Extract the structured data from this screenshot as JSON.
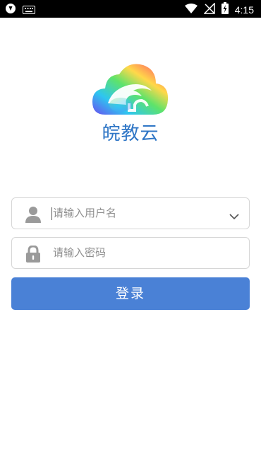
{
  "status_bar": {
    "time": "4:15",
    "left_icons": [
      "shield-icon",
      "keyboard-icon"
    ],
    "right_icons": [
      "wifi-icon",
      "no-signal-icon",
      "battery-charging-icon"
    ]
  },
  "app": {
    "name": "皖教云",
    "logo": "cloud-logo"
  },
  "login_form": {
    "username_placeholder": "请输入用户名",
    "password_placeholder": "请输入密码",
    "submit_label": "登录"
  },
  "colors": {
    "accent": "#4a81d6",
    "title": "#2f76c6",
    "status_bar_bg": "#000000"
  }
}
